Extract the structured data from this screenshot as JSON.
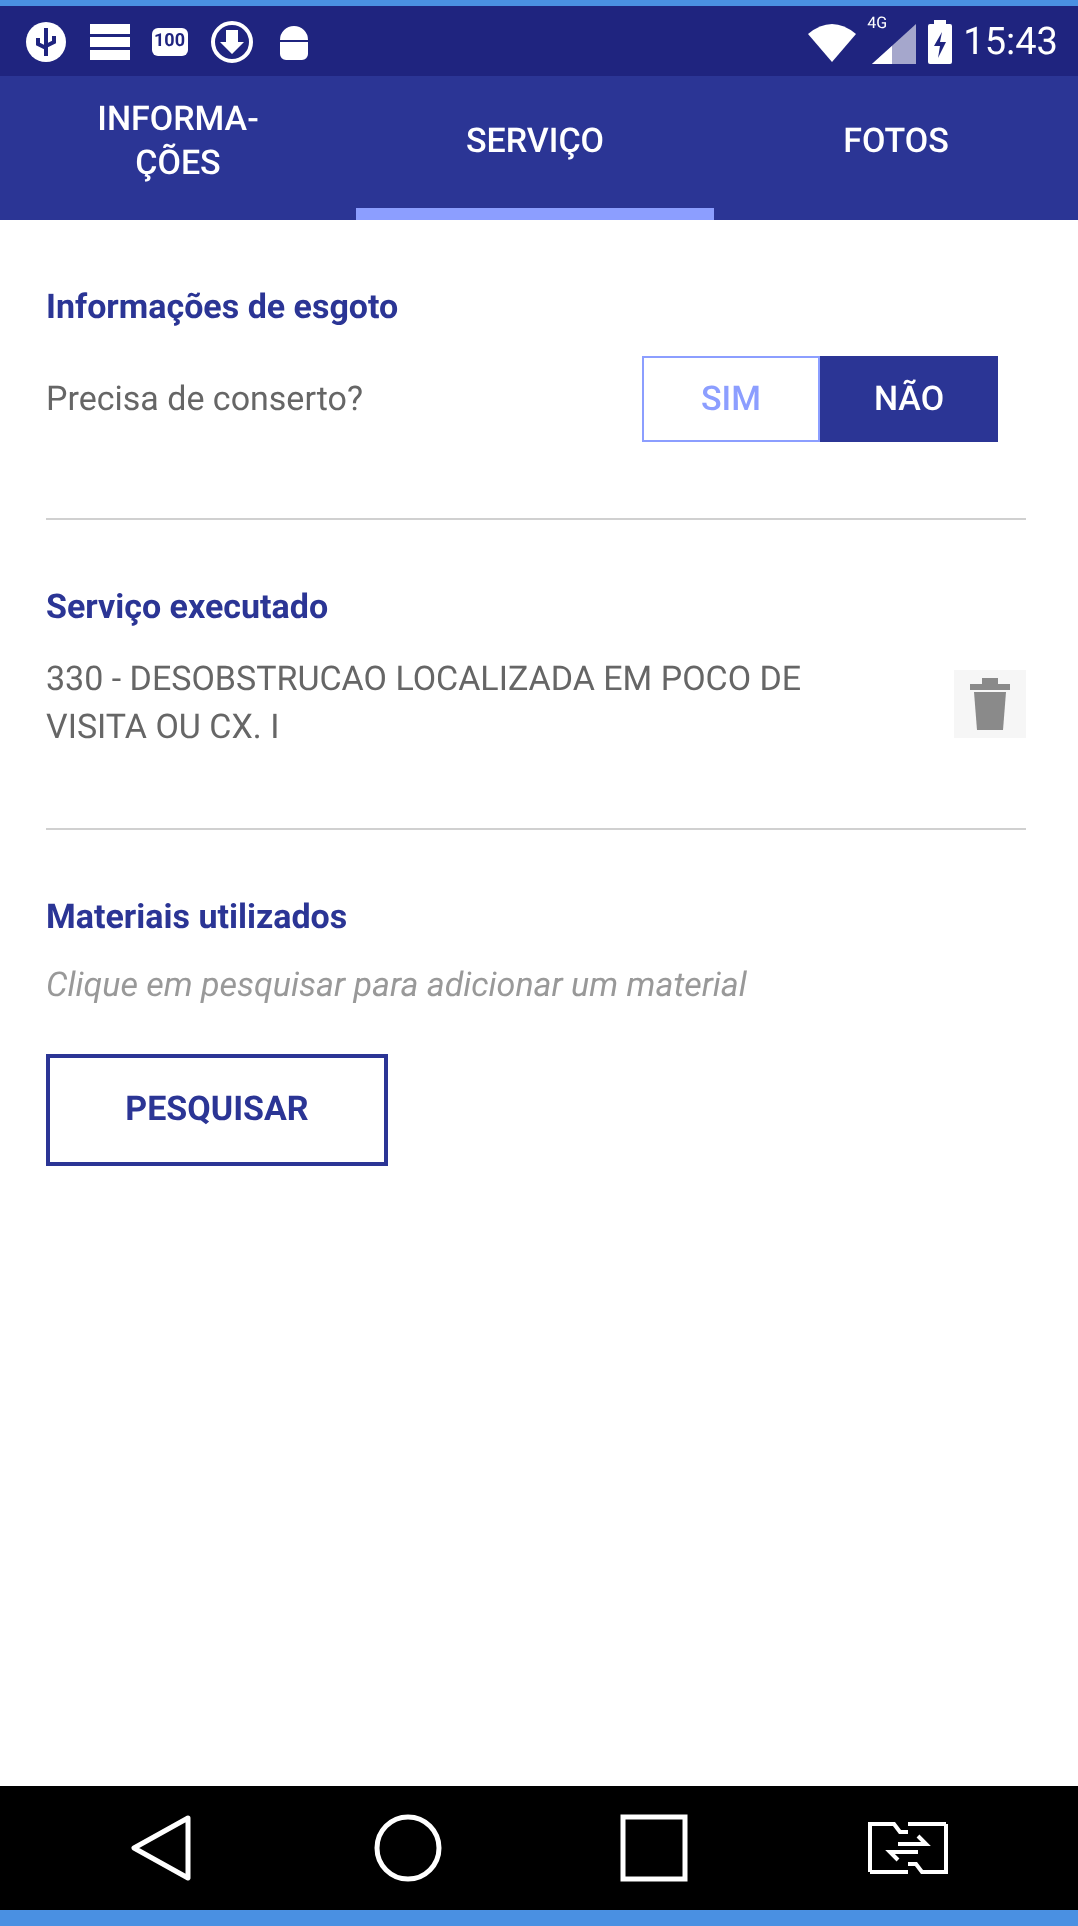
{
  "status_bar": {
    "notification_count": "100",
    "network": "4G",
    "time": "15:43"
  },
  "tabs": [
    {
      "label": "INFORMA-\nÇÕES",
      "selected": false
    },
    {
      "label": "SERVIÇO",
      "selected": true
    },
    {
      "label": "FOTOS",
      "selected": false
    }
  ],
  "sewer_info": {
    "title": "Informações de esgoto",
    "question": "Precisa de conserto?",
    "options": [
      {
        "label": "SIM",
        "selected": false
      },
      {
        "label": "NÃO",
        "selected": true
      }
    ]
  },
  "service": {
    "title": "Serviço executado",
    "item": "330 - DESOBSTRUCAO LOCALIZADA EM POCO DE VISITA OU CX. I"
  },
  "materials": {
    "title": "Materiais utilizados",
    "hint": "Clique em pesquisar para adicionar um material",
    "button": "PESQUISAR"
  }
}
